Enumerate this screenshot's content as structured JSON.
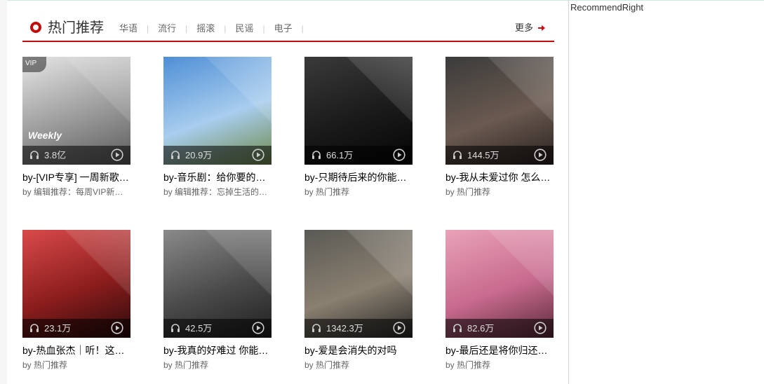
{
  "header": {
    "title": "热门推荐",
    "tags": [
      "华语",
      "流行",
      "摇滚",
      "民谣",
      "电子"
    ],
    "more_label": "更多"
  },
  "playlists": [
    {
      "plays": "3.8亿",
      "name": "by-[VIP专享] 一周新歌推荐",
      "by": "by 编辑推荐：每周VIP新歌推荐",
      "vip": "VIP",
      "art_overlay": "Weekly",
      "colors": [
        "#e6e6e6",
        "#9a9a9a",
        "#5a5a5a"
      ]
    },
    {
      "plays": "20.9万",
      "name": "by-音乐剧：给你要的美好",
      "by": "by 编辑推荐：忘掉生活的烦恼",
      "colors": [
        "#4f8fd6",
        "#a8cdee",
        "#6f8a4a"
      ]
    },
    {
      "plays": "66.1万",
      "name": "by-只期待后来的你能快乐",
      "by": "by 热门推荐",
      "colors": [
        "#3a3a3a",
        "#1a1a1a",
        "#050505"
      ]
    },
    {
      "plays": "144.5万",
      "name": "by-我从未爱过你 怎么会放手",
      "by": "by 热门推荐",
      "colors": [
        "#3b3b3b",
        "#6a5a50",
        "#2a2220"
      ]
    },
    {
      "plays": "23.1万",
      "name": "by-热血张杰｜听！这个男人",
      "by": "by 热门推荐",
      "colors": [
        "#d94a4a",
        "#8c1d1d",
        "#2a0a0a"
      ]
    },
    {
      "plays": "42.5万",
      "name": "by-我真的好难过 你能陪陪我吗",
      "by": "by 热门推荐",
      "colors": [
        "#8a8a8a",
        "#4a4a4a",
        "#1f1f1f"
      ]
    },
    {
      "plays": "1342.3万",
      "name": "by-爱是会消失的对吗",
      "by": "by 热门推荐",
      "colors": [
        "#5a5a55",
        "#8a7f70",
        "#2a2a28"
      ]
    },
    {
      "plays": "82.6万",
      "name": "by-最后还是将你归还人海",
      "by": "by 热门推荐",
      "colors": [
        "#e9a2b8",
        "#c86a8e",
        "#5a2a3a"
      ]
    }
  ],
  "right_panel": {
    "title": "RecommendRight"
  },
  "icons": {
    "headphones": "headphones-icon",
    "play": "play-icon",
    "more_arrow": "arrow-right-icon",
    "title_ring": "record-ring-icon"
  },
  "accent_color": "#c10d0c"
}
